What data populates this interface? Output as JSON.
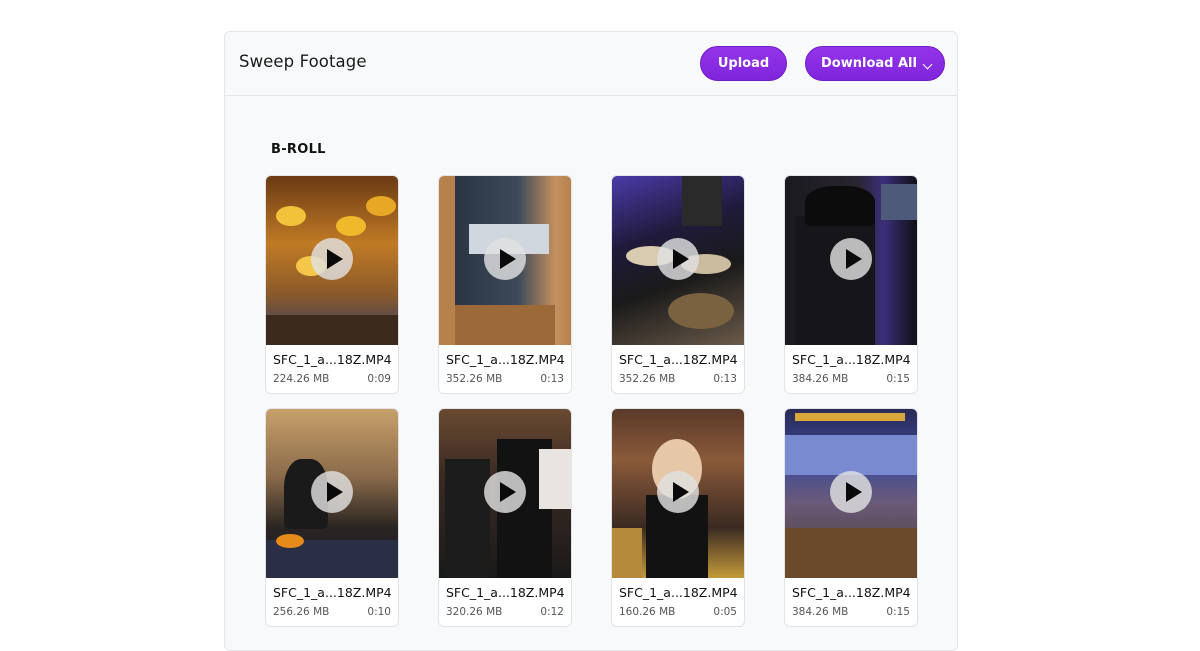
{
  "panel": {
    "title": "Sweep Footage",
    "upload_label": "Upload",
    "download_all_label": "Download All"
  },
  "section": {
    "title": "B-ROLL"
  },
  "videos": [
    {
      "name": "SFC_1_a...18Z.MP4",
      "size": "224.26 MB",
      "duration": "0:09"
    },
    {
      "name": "SFC_1_a...18Z.MP4",
      "size": "352.26 MB",
      "duration": "0:13"
    },
    {
      "name": "SFC_1_a...18Z.MP4",
      "size": "352.26 MB",
      "duration": "0:13"
    },
    {
      "name": "SFC_1_a...18Z.MP4",
      "size": "384.26 MB",
      "duration": "0:15"
    },
    {
      "name": "SFC_1_a...18Z.MP4",
      "size": "256.26 MB",
      "duration": "0:10"
    },
    {
      "name": "SFC_1_a...18Z.MP4",
      "size": "320.26 MB",
      "duration": "0:12"
    },
    {
      "name": "SFC_1_a...18Z.MP4",
      "size": "160.26 MB",
      "duration": "0:05"
    },
    {
      "name": "SFC_1_a...18Z.MP4",
      "size": "384.26 MB",
      "duration": "0:15"
    }
  ],
  "icons": {
    "play": "play-icon",
    "chevron": "chevron-down-icon"
  },
  "colors": {
    "accent": "#8a2be2",
    "panel_bg": "#f8f9fb",
    "border": "#e4e6ea"
  }
}
